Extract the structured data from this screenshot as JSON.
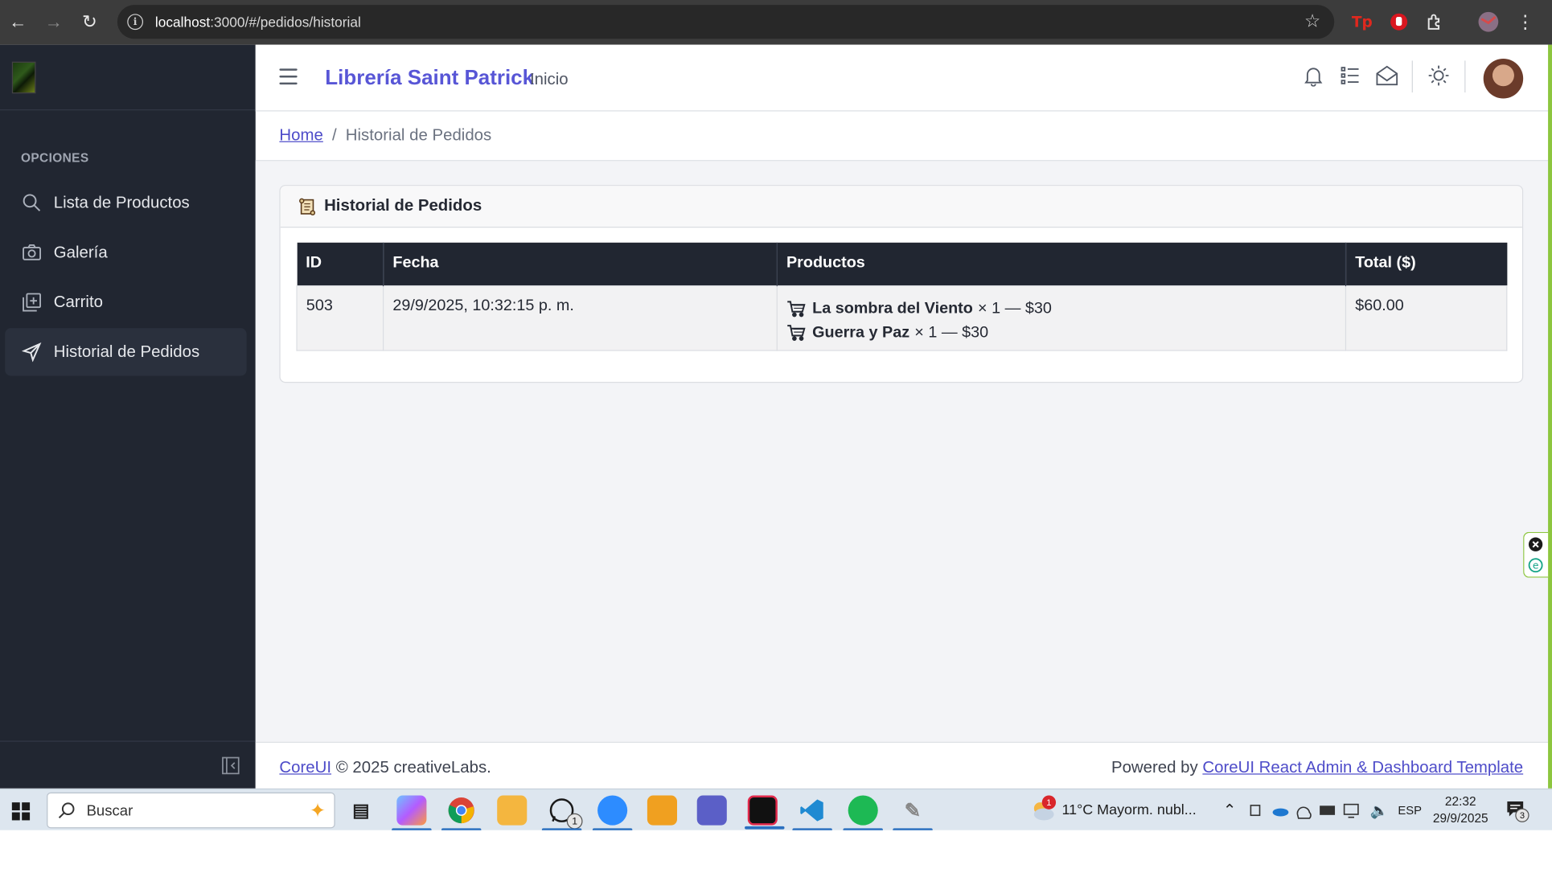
{
  "browser": {
    "url_host": "localhost",
    "url_path": ":3000/#/pedidos/historial"
  },
  "sidebar": {
    "section_title": "OPCIONES",
    "items": [
      {
        "label": "Lista de Productos",
        "icon": "search-icon"
      },
      {
        "label": "Galería",
        "icon": "camera-icon"
      },
      {
        "label": "Carrito",
        "icon": "library-add-icon"
      },
      {
        "label": "Historial de Pedidos",
        "icon": "paper-plane-icon",
        "active": true
      }
    ]
  },
  "header": {
    "brand": "Librería Saint Patrick",
    "home_link": "Inicio"
  },
  "breadcrumb": {
    "home": "Home",
    "separator": "/",
    "current": "Historial de Pedidos"
  },
  "card": {
    "title": "Historial de Pedidos",
    "columns": [
      "ID",
      "Fecha",
      "Productos",
      "Total ($)"
    ],
    "rows": [
      {
        "id": "503",
        "fecha": "29/9/2025, 10:32:15 p. m.",
        "productos": [
          {
            "name": "La sombra del Viento",
            "detail": "× 1 — $30"
          },
          {
            "name": "Guerra y Paz",
            "detail": "× 1 — $30"
          }
        ],
        "total": "$60.00"
      }
    ]
  },
  "footer": {
    "left_link": "CoreUI",
    "left_text": "© 2025 creativeLabs.",
    "right_text": "Powered by",
    "right_link": "CoreUI React Admin & Dashboard Template"
  },
  "taskbar": {
    "search_placeholder": "Buscar",
    "whatsapp_badge": "1",
    "weather": "11°C  Mayorm. nubl...",
    "weather_badge": "1",
    "language": "ESP",
    "time": "22:32",
    "date": "29/9/2025",
    "notification_count": "3"
  },
  "colors": {
    "sidebar_bg": "#212631",
    "brand": "#5856d6",
    "link": "#4e4cc9",
    "accent_border": "#8dc63f"
  }
}
